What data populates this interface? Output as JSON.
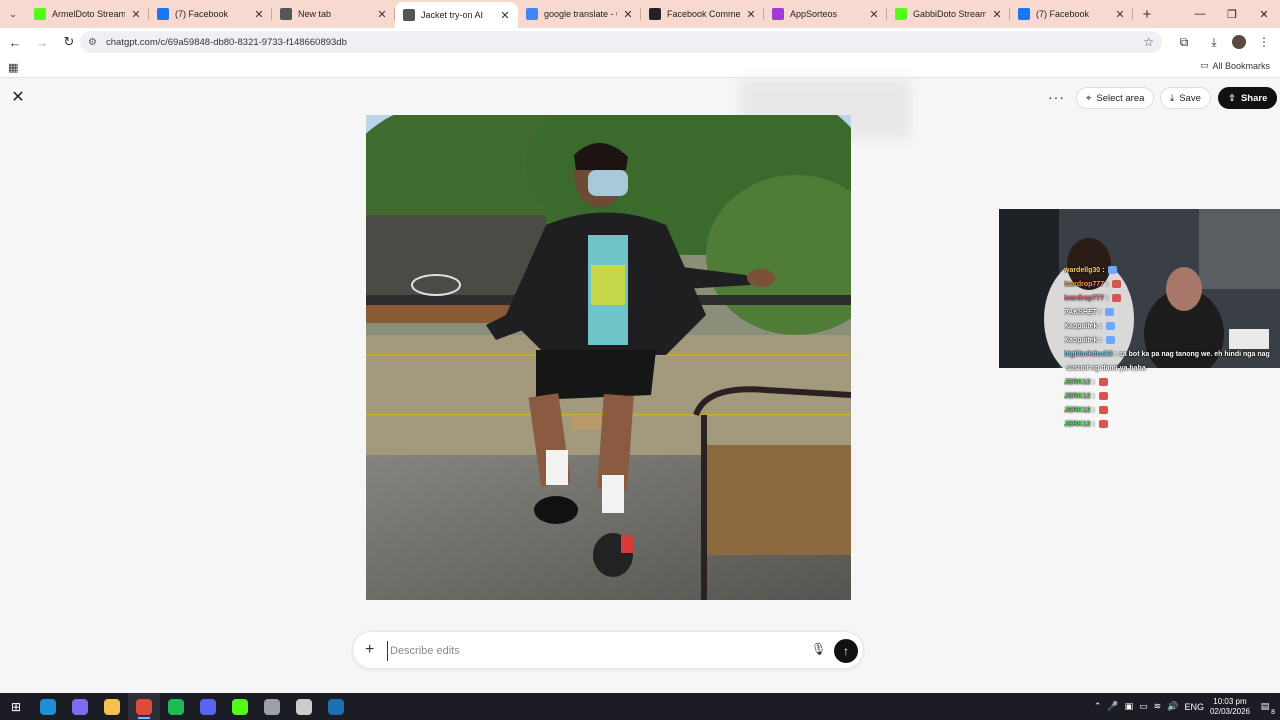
{
  "browser": {
    "tabs": [
      {
        "title": "ArmelDoto Stream - ",
        "favicon": "kick-icon",
        "color": "#53fc18",
        "active": false
      },
      {
        "title": "(7) Facebook",
        "favicon": "facebook-icon",
        "color": "#1877f2",
        "active": false
      },
      {
        "title": "New tab",
        "favicon": "globe-icon",
        "color": "#555555",
        "active": false
      },
      {
        "title": "Jacket try-on AI",
        "favicon": "chatgpt-icon",
        "color": "#555555",
        "active": true
      },
      {
        "title": "google translate - Go",
        "favicon": "google-icon",
        "color": "#4285f4",
        "active": false
      },
      {
        "title": "Facebook Comment ",
        "favicon": "comment-tool-icon",
        "color": "#222222",
        "active": false
      },
      {
        "title": "AppSorteos",
        "favicon": "appsorteos-icon",
        "color": "#a23bd6",
        "active": false
      },
      {
        "title": "GabbiDoto Stream - ",
        "favicon": "kick-icon",
        "color": "#53fc18",
        "active": false
      },
      {
        "title": "(7) Facebook",
        "favicon": "facebook-icon",
        "color": "#1877f2",
        "active": false
      }
    ],
    "url": "chatgpt.com/c/69a59848-db80-8321-9733-f148660893db",
    "bookmarks_label": "All Bookmarks"
  },
  "toolbar": {
    "select_area_label": "Select area",
    "save_label": "Save",
    "share_label": "Share"
  },
  "composer": {
    "placeholder": "Describe edits"
  },
  "stream_chat": [
    {
      "user": "wardellg30",
      "color": "#ffd166",
      "msg": "",
      "emote": "#6fa8ff"
    },
    {
      "user": "tsardrop777",
      "color": "#ff9f43",
      "msg": "",
      "emote": "#d9534f"
    },
    {
      "user": "teardrop777",
      "color": "#ff6b81",
      "msg": "",
      "emote": "#d9534f"
    },
    {
      "user": "PAKSHET",
      "color": "#ffffff",
      "msg": "",
      "emote": "#6fa8ff"
    },
    {
      "user": "Kaopaitek",
      "color": "#ffffff",
      "msg": "",
      "emote": "#6fa8ff"
    },
    {
      "user": "Kaopaitek",
      "color": "#ffffff",
      "msg": "",
      "emote": "#6fa8ff"
    },
    {
      "user": "bigblackduck3",
      "color": "#5cd6ff",
      "msg": "sa bot ka pa nag tanong we. eh hindi nga nag",
      "emote": ""
    },
    {
      "user": "",
      "color": "#ffffff",
      "msg": "susuot ng dami ya haha",
      "emote": ""
    },
    {
      "user": "JERK12",
      "color": "#4cd964",
      "msg": "",
      "emote": "#d9534f"
    },
    {
      "user": "JERK12",
      "color": "#4cd964",
      "msg": "",
      "emote": "#d9534f"
    },
    {
      "user": "JERK12",
      "color": "#4cd964",
      "msg": "",
      "emote": "#d9534f"
    },
    {
      "user": "JERK12",
      "color": "#4cd964",
      "msg": "",
      "emote": "#d9534f"
    }
  ],
  "taskbar": {
    "apps": [
      {
        "name": "edge-icon",
        "color": "#1f8fd6"
      },
      {
        "name": "copilot-icon",
        "color": "#7a6cf0"
      },
      {
        "name": "file-explorer-icon",
        "color": "#f2c14e"
      },
      {
        "name": "chrome-icon",
        "color": "#e04a3a"
      },
      {
        "name": "spotify-icon",
        "color": "#1db954"
      },
      {
        "name": "discord-icon",
        "color": "#5865f2"
      },
      {
        "name": "kick-icon",
        "color": "#53fc18"
      },
      {
        "name": "settings-icon",
        "color": "#9aa0a6"
      },
      {
        "name": "app-c-icon",
        "color": "#cccccc"
      },
      {
        "name": "steam-icon",
        "color": "#1b6fb0"
      }
    ],
    "language": "ENG",
    "time": "10:03 pm",
    "date": "02/03/2026",
    "notification_count": "8"
  }
}
